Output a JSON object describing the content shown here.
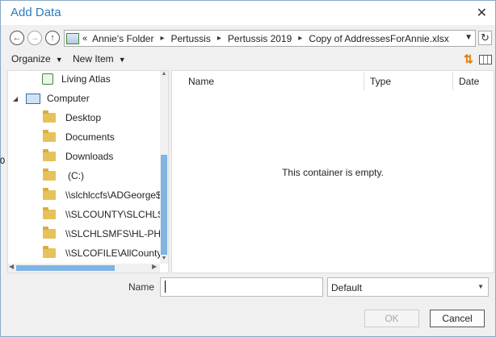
{
  "dialog": {
    "title": "Add Data",
    "close_glyph": "✕"
  },
  "nav": {
    "back_glyph": "←",
    "forward_glyph": "→",
    "up_glyph": "↑",
    "path_lead": "«",
    "breadcrumbs": [
      "Annie's Folder",
      "Pertussis",
      "Pertussis 2019",
      "Copy of AddressesForAnnie.xlsx"
    ],
    "crumb_separator": "▸",
    "dropdown_glyph": "▼",
    "refresh_glyph": "↻"
  },
  "toolbar": {
    "organize_label": "Organize",
    "new_item_label": "New Item",
    "caret_glyph": "▼",
    "sort_glyph": "⇅"
  },
  "tree": {
    "items": [
      {
        "label": "Living Atlas",
        "icon": "living-atlas-icon"
      },
      {
        "label": "Computer",
        "icon": "computer-icon",
        "expanded": true
      },
      {
        "label": "Desktop",
        "icon": "folder-icon"
      },
      {
        "label": "Documents",
        "icon": "folder-icon"
      },
      {
        "label": "Downloads",
        "icon": "folder-icon"
      },
      {
        "label": "(C:)",
        "icon": "folder-icon"
      },
      {
        "label": "\\\\slchlccfs\\ADGeorge$",
        "icon": "folder-icon"
      },
      {
        "label": "\\\\SLCOUNTY\\SLCHLSH",
        "icon": "folder-icon"
      },
      {
        "label": "\\\\SLCHLSMFS\\HL-PHI$",
        "icon": "folder-icon"
      },
      {
        "label": "\\\\SLCOFILE\\AllCountyS",
        "icon": "folder-icon"
      }
    ],
    "expander_glyph": "◢"
  },
  "content": {
    "columns": [
      "Name",
      "Type",
      "Date"
    ],
    "empty_message": "This container is empty."
  },
  "footer": {
    "name_label": "Name",
    "name_value": "",
    "filter_value": "Default",
    "ok_label": "OK",
    "cancel_label": "Cancel"
  },
  "background_glyph": "0"
}
